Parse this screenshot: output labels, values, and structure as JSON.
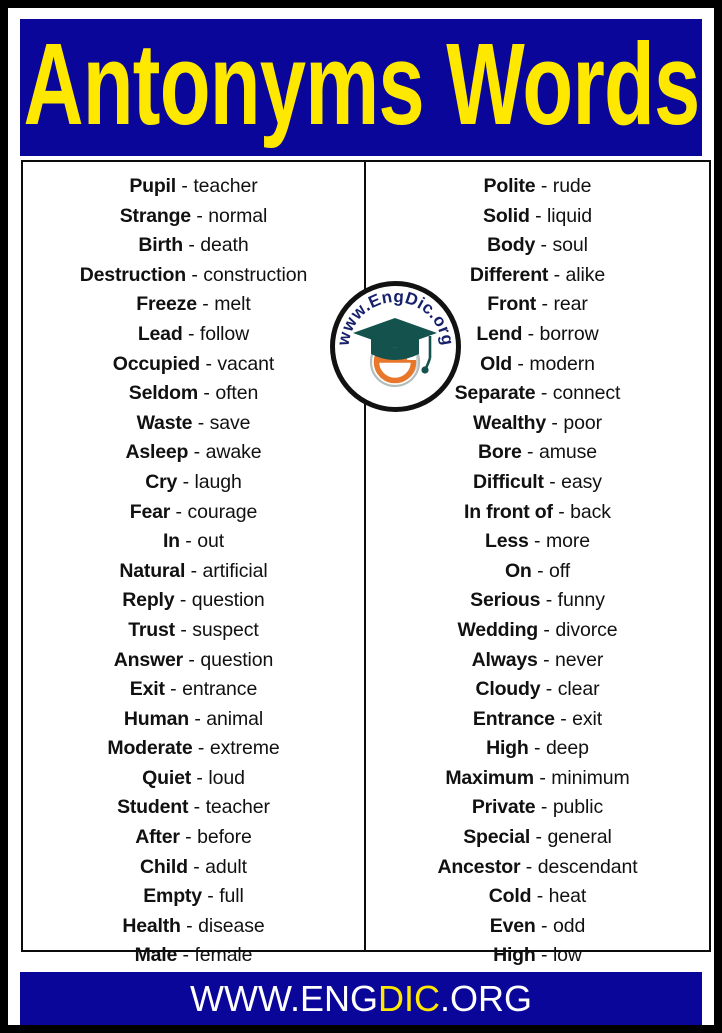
{
  "header": {
    "title": "Antonyms Words",
    "background_color": "#0a069a",
    "title_color": "#ffe800"
  },
  "logo": {
    "name": "engdic-logo",
    "curved_text": "www.EngDic.org",
    "letter": "e",
    "ring_color": "#101010",
    "text_color": "#17216b",
    "cap_color": "#14524e",
    "letter_color": "#e8762b"
  },
  "table": {
    "columns": [
      {
        "name": "left-column",
        "rows": [
          {
            "term": "Pupil",
            "sep": "-",
            "antonym": "teacher"
          },
          {
            "term": "Strange",
            "sep": "-",
            "antonym": "normal"
          },
          {
            "term": "Birth",
            "sep": "-",
            "antonym": "death"
          },
          {
            "term": "Destruction",
            "sep": "-",
            "antonym": "construction"
          },
          {
            "term": "Freeze",
            "sep": "-",
            "antonym": "melt"
          },
          {
            "term": "Lead",
            "sep": "-",
            "antonym": "follow"
          },
          {
            "term": "Occupied",
            "sep": "-",
            "antonym": "vacant"
          },
          {
            "term": "Seldom",
            "sep": "-",
            "antonym": "often"
          },
          {
            "term": "Waste",
            "sep": "-",
            "antonym": "save"
          },
          {
            "term": "Asleep",
            "sep": "-",
            "antonym": "awake"
          },
          {
            "term": "Cry",
            "sep": "-",
            "antonym": "laugh"
          },
          {
            "term": "Fear",
            "sep": "-",
            "antonym": "courage"
          },
          {
            "term": "In",
            "sep": "-",
            "antonym": "out"
          },
          {
            "term": "Natural",
            "sep": "-",
            "antonym": "artificial"
          },
          {
            "term": "Reply",
            "sep": "-",
            "antonym": "question"
          },
          {
            "term": "Trust",
            "sep": "-",
            "antonym": "suspect"
          },
          {
            "term": "Answer",
            "sep": "-",
            "antonym": "question"
          },
          {
            "term": "Exit",
            "sep": "-",
            "antonym": "entrance"
          },
          {
            "term": "Human",
            "sep": "-",
            "antonym": "animal"
          },
          {
            "term": "Moderate",
            "sep": "-",
            "antonym": "extreme"
          },
          {
            "term": "Quiet",
            "sep": "-",
            "antonym": "loud"
          },
          {
            "term": "Student",
            "sep": "-",
            "antonym": "teacher"
          },
          {
            "term": "After",
            "sep": "-",
            "antonym": "before"
          },
          {
            "term": "Child",
            "sep": "-",
            "antonym": "adult"
          },
          {
            "term": "Empty",
            "sep": "-",
            "antonym": "full"
          },
          {
            "term": "Health",
            "sep": "-",
            "antonym": "disease"
          },
          {
            "term": "Male",
            "sep": "-",
            "antonym": "female"
          }
        ]
      },
      {
        "name": "right-column",
        "rows": [
          {
            "term": "Polite",
            "sep": "-",
            "antonym": "rude"
          },
          {
            "term": "Solid",
            "sep": "-",
            "antonym": "liquid"
          },
          {
            "term": "Body",
            "sep": "-",
            "antonym": "soul"
          },
          {
            "term": "Different",
            "sep": "-",
            "antonym": "alike"
          },
          {
            "term": "Front",
            "sep": "-",
            "antonym": "rear"
          },
          {
            "term": "Lend",
            "sep": "-",
            "antonym": "borrow"
          },
          {
            "term": "Old",
            "sep": "-",
            "antonym": "modern"
          },
          {
            "term": "Separate",
            "sep": "-",
            "antonym": "connect"
          },
          {
            "term": "Wealthy",
            "sep": "-",
            "antonym": "poor"
          },
          {
            "term": "Bore",
            "sep": "-",
            "antonym": "amuse"
          },
          {
            "term": "Difficult",
            "sep": "-",
            "antonym": "easy"
          },
          {
            "term": "In front of",
            "sep": "-",
            "antonym": "back"
          },
          {
            "term": "Less",
            "sep": "-",
            "antonym": "more"
          },
          {
            "term": "On",
            "sep": "-",
            "antonym": "off"
          },
          {
            "term": "Serious",
            "sep": "-",
            "antonym": "funny"
          },
          {
            "term": "Wedding",
            "sep": "-",
            "antonym": "divorce"
          },
          {
            "term": "Always",
            "sep": "-",
            "antonym": "never"
          },
          {
            "term": "Cloudy",
            "sep": "-",
            "antonym": "clear"
          },
          {
            "term": "Entrance",
            "sep": "-",
            "antonym": "exit"
          },
          {
            "term": "High",
            "sep": "-",
            "antonym": "deep"
          },
          {
            "term": "Maximum",
            "sep": "-",
            "antonym": "minimum"
          },
          {
            "term": "Private",
            "sep": "-",
            "antonym": "public"
          },
          {
            "term": "Special",
            "sep": "-",
            "antonym": "general"
          },
          {
            "term": "Ancestor",
            "sep": "-",
            "antonym": "descendant"
          },
          {
            "term": "Cold",
            "sep": "-",
            "antonym": "heat"
          },
          {
            "term": "Even",
            "sep": "-",
            "antonym": "odd"
          },
          {
            "term": "High",
            "sep": "-",
            "antonym": "low"
          }
        ]
      }
    ]
  },
  "footer": {
    "text_plain": "WWW.ENGDIC.ORG",
    "part_1": "WWW.ENG",
    "part_highlight": "DIC",
    "part_2": ".ORG",
    "background_color": "#0a069a",
    "text_color": "#ffffff",
    "highlight_color": "#ffe800"
  }
}
